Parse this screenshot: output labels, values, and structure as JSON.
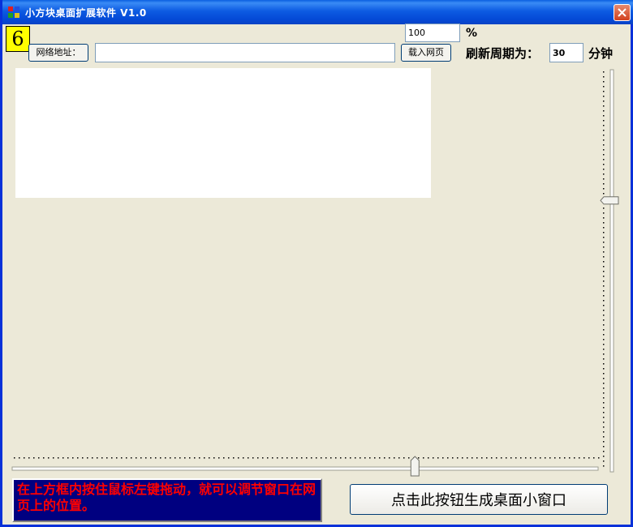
{
  "window": {
    "title": "小方块桌面扩展软件 V1.0"
  },
  "toolbar": {
    "counter": "6",
    "url_label": "网络地址：",
    "url_value": "",
    "load_button": "载入网页",
    "zoom_value": "100",
    "zoom_unit": "%",
    "refresh_label": "刷新周期为：",
    "refresh_value": "30",
    "refresh_unit": "分钟"
  },
  "sliders": {
    "vertical_position": 0.32,
    "horizontal_position": 0.69
  },
  "footer": {
    "hint_text": "在上方框内按住鼠标左键拖动，就可以调节窗口在网页上的位置。",
    "generate_button": "点击此按钮生成桌面小窗口"
  },
  "colors": {
    "titlebar": "#0a5fe0",
    "hint_background": "#000080",
    "hint_text": "#ff0000",
    "counter_background": "#ffff00"
  }
}
